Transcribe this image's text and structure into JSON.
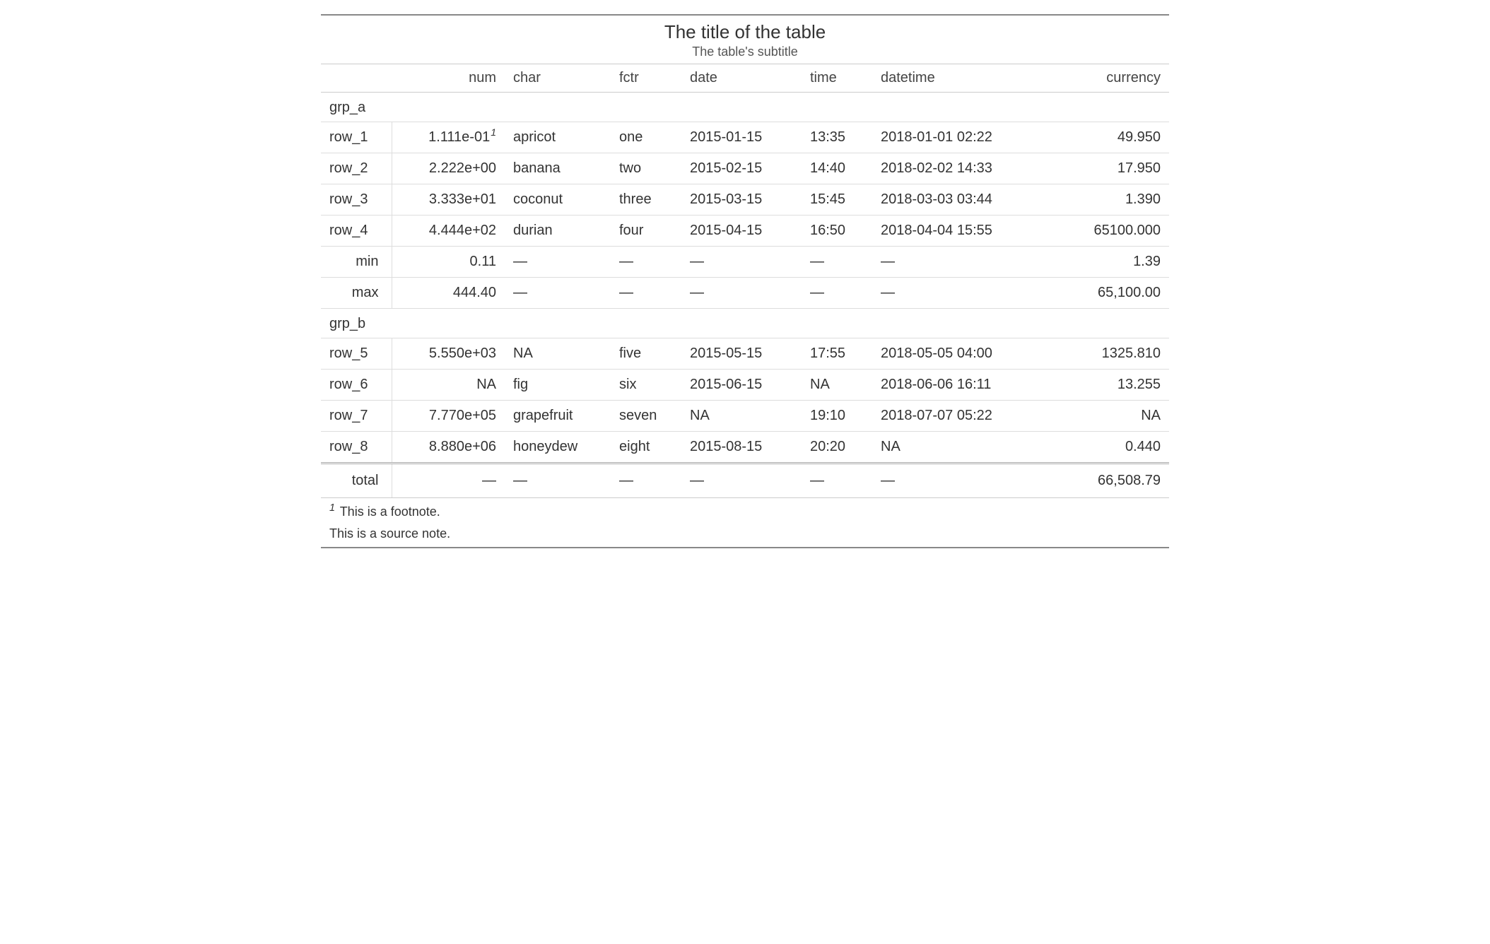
{
  "title": "The title of the table",
  "subtitle": "The table's subtitle",
  "columns": {
    "num": "num",
    "char": "char",
    "fctr": "fctr",
    "date": "date",
    "time": "time",
    "datetime": "datetime",
    "currency": "currency"
  },
  "groups": [
    {
      "label": "grp_a",
      "rows": [
        {
          "stub": "row_1",
          "num": "1.111e-01",
          "num_mark": "1",
          "char": "apricot",
          "fctr": "one",
          "date": "2015-01-15",
          "time": "13:35",
          "datetime": "2018-01-01 02:22",
          "currency": "49.950"
        },
        {
          "stub": "row_2",
          "num": "2.222e+00",
          "char": "banana",
          "fctr": "two",
          "date": "2015-02-15",
          "time": "14:40",
          "datetime": "2018-02-02 14:33",
          "currency": "17.950"
        },
        {
          "stub": "row_3",
          "num": "3.333e+01",
          "char": "coconut",
          "fctr": "three",
          "date": "2015-03-15",
          "time": "15:45",
          "datetime": "2018-03-03 03:44",
          "currency": "1.390"
        },
        {
          "stub": "row_4",
          "num": "4.444e+02",
          "char": "durian",
          "fctr": "four",
          "date": "2015-04-15",
          "time": "16:50",
          "datetime": "2018-04-04 15:55",
          "currency": "65100.000"
        }
      ],
      "summary": [
        {
          "stub": "min",
          "num": "0.11",
          "char": "—",
          "fctr": "—",
          "date": "—",
          "time": "—",
          "datetime": "—",
          "currency": "1.39"
        },
        {
          "stub": "max",
          "num": "444.40",
          "char": "—",
          "fctr": "—",
          "date": "—",
          "time": "—",
          "datetime": "—",
          "currency": "65,100.00"
        }
      ]
    },
    {
      "label": "grp_b",
      "rows": [
        {
          "stub": "row_5",
          "num": "5.550e+03",
          "char": "NA",
          "fctr": "five",
          "date": "2015-05-15",
          "time": "17:55",
          "datetime": "2018-05-05 04:00",
          "currency": "1325.810"
        },
        {
          "stub": "row_6",
          "num": "NA",
          "char": "fig",
          "fctr": "six",
          "date": "2015-06-15",
          "time": "NA",
          "datetime": "2018-06-06 16:11",
          "currency": "13.255"
        },
        {
          "stub": "row_7",
          "num": "7.770e+05",
          "char": "grapefruit",
          "fctr": "seven",
          "date": "NA",
          "time": "19:10",
          "datetime": "2018-07-07 05:22",
          "currency": "NA"
        },
        {
          "stub": "row_8",
          "num": "8.880e+06",
          "char": "honeydew",
          "fctr": "eight",
          "date": "2015-08-15",
          "time": "20:20",
          "datetime": "NA",
          "currency": "0.440"
        }
      ],
      "summary": []
    }
  ],
  "grand": {
    "stub": "total",
    "num": "—",
    "char": "—",
    "fctr": "—",
    "date": "—",
    "time": "—",
    "datetime": "—",
    "currency": "66,508.79"
  },
  "footnotes": [
    {
      "mark": "1",
      "text": " This is a footnote."
    }
  ],
  "source_note": "This is a source note."
}
